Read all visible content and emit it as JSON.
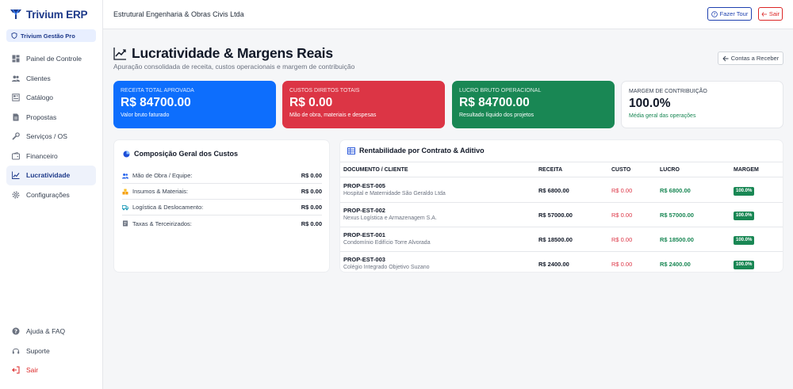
{
  "app": {
    "name": "Trivium ERP",
    "plan": "Trivium Gestão Pro"
  },
  "sidebar": {
    "items": [
      {
        "label": "Painel de Controle",
        "icon": "dashboard-icon"
      },
      {
        "label": "Clientes",
        "icon": "users-icon"
      },
      {
        "label": "Catálogo",
        "icon": "catalog-icon"
      },
      {
        "label": "Propostas",
        "icon": "document-icon"
      },
      {
        "label": "Serviços / OS",
        "icon": "tools-icon"
      },
      {
        "label": "Financeiro",
        "icon": "wallet-icon"
      },
      {
        "label": "Lucratividade",
        "icon": "chart-line-icon",
        "active": true
      },
      {
        "label": "Configurações",
        "icon": "gear-icon"
      }
    ],
    "bottom": [
      {
        "label": "Ajuda & FAQ",
        "icon": "help-icon"
      },
      {
        "label": "Suporte",
        "icon": "headset-icon"
      },
      {
        "label": "Sair",
        "icon": "logout-icon"
      }
    ]
  },
  "header": {
    "company": "Estrutural Engenharia & Obras Civis Ltda",
    "tour_label": "Fazer Tour",
    "exit_label": "Sair"
  },
  "page": {
    "title": "Lucratividade & Margens Reais",
    "subtitle": "Apuração consolidada de receita, custos operacionais e margem de contribuição",
    "back_label": "Contas a Receber"
  },
  "kpis": {
    "revenue": {
      "label": "Receita Total Aprovada",
      "value": "R$ 84700.00",
      "desc": "Valor bruto faturado"
    },
    "costs": {
      "label": "Custos Diretos Totais",
      "value": "R$ 0.00",
      "desc": "Mão de obra, materiais e despesas"
    },
    "profit": {
      "label": "Lucro Bruto Operacional",
      "value": "R$ 84700.00",
      "desc": "Resultado líquido dos projetos"
    },
    "margin": {
      "label": "Margem de Contribuição",
      "value": "100.0%",
      "desc": "Média geral das operações"
    }
  },
  "cost_composition": {
    "title": "Composição Geral dos Custos",
    "rows": [
      {
        "label": "Mão de Obra / Equipe:",
        "value": "R$ 0.00"
      },
      {
        "label": "Insumos & Materiais:",
        "value": "R$ 0.00"
      },
      {
        "label": "Logística & Deslocamento:",
        "value": "R$ 0.00"
      },
      {
        "label": "Taxas & Terceirizados:",
        "value": "R$ 0.00"
      }
    ]
  },
  "profitability": {
    "title": "Rentabilidade por Contrato & Aditivo",
    "headers": {
      "doc": "DOCUMENTO / CLIENTE",
      "revenue": "RECEITA",
      "cost": "CUSTO",
      "profit": "LUCRO",
      "margin": "MARGEM"
    },
    "rows": [
      {
        "code": "PROP-EST-005",
        "client": "Hospital e Maternidade São Geraldo Ltda",
        "revenue": "R$ 6800.00",
        "cost": "R$ 0.00",
        "profit": "R$ 6800.00",
        "margin": "100.0%"
      },
      {
        "code": "PROP-EST-002",
        "client": "Nexus Logística e Armazenagem S.A.",
        "revenue": "R$ 57000.00",
        "cost": "R$ 0.00",
        "profit": "R$ 57000.00",
        "margin": "100.0%"
      },
      {
        "code": "PROP-EST-001",
        "client": "Condomínio Edifício Torre Alvorada",
        "revenue": "R$ 18500.00",
        "cost": "R$ 0.00",
        "profit": "R$ 18500.00",
        "margin": "100.0%"
      },
      {
        "code": "PROP-EST-003",
        "client": "Colégio Integrado Objetivo Suzano",
        "revenue": "R$ 2400.00",
        "cost": "R$ 0.00",
        "profit": "R$ 2400.00",
        "margin": "100.0%"
      }
    ]
  },
  "colors": {
    "brand": "#1e3a8a",
    "blue": "#0d6efd",
    "red": "#dc3545",
    "green": "#198754"
  }
}
